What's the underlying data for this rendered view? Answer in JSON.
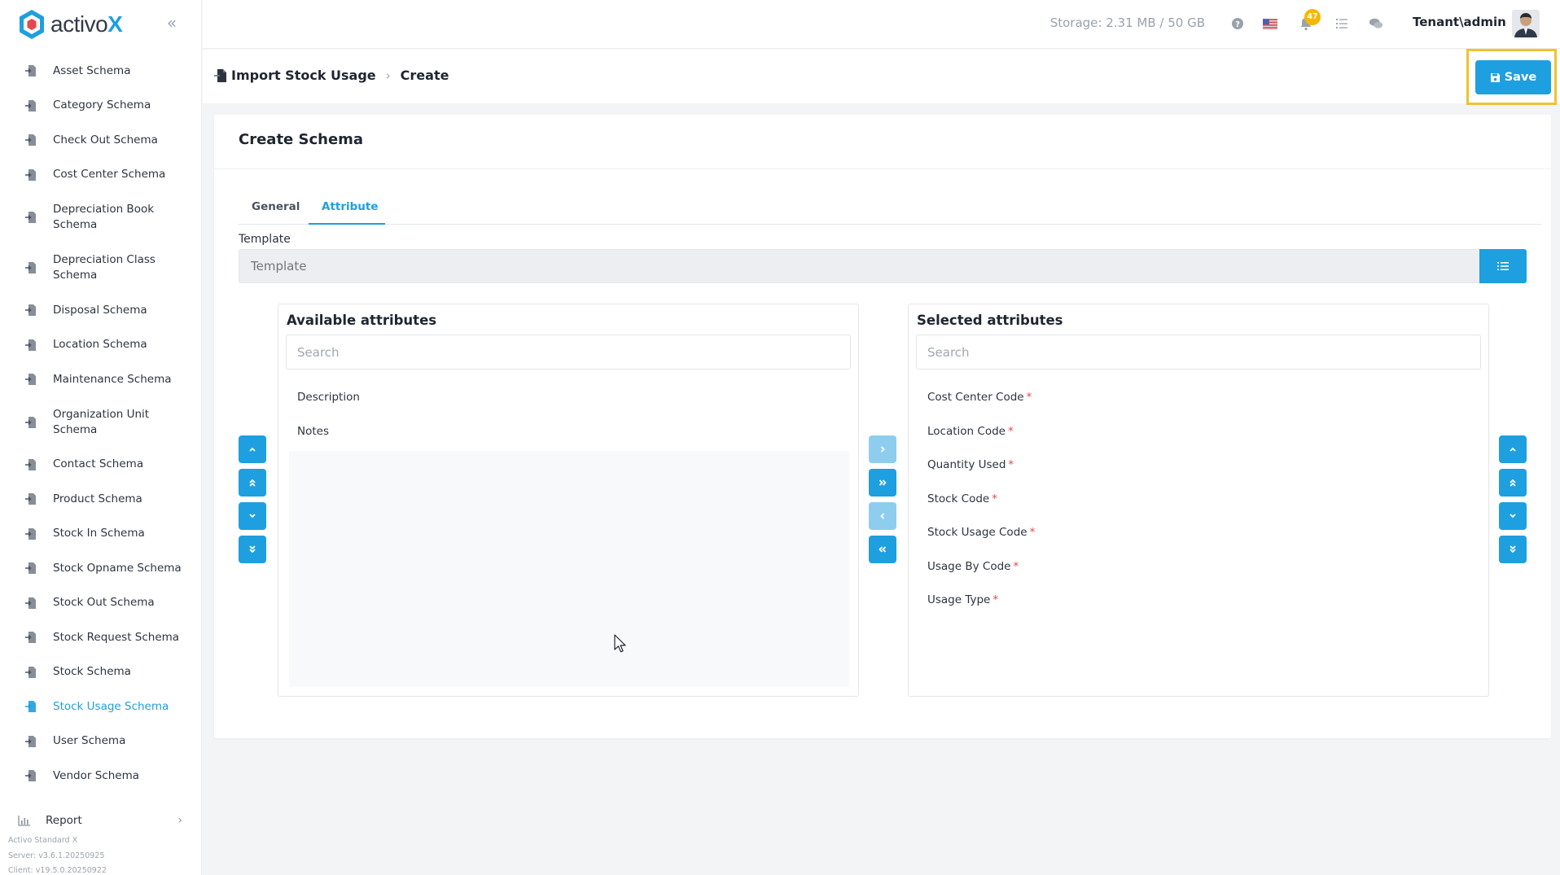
{
  "app": {
    "logo_text": "activo",
    "logo_accent": "X",
    "brand_color": "#1e9fdf"
  },
  "sidebar": {
    "items": [
      {
        "label": "Asset Schema",
        "icon": "import-doc-icon",
        "two_line": false,
        "active": false
      },
      {
        "label": "Category Schema",
        "icon": "import-doc-icon",
        "two_line": false,
        "active": false
      },
      {
        "label": "Check Out Schema",
        "icon": "import-doc-icon",
        "two_line": false,
        "active": false
      },
      {
        "label": "Cost Center Schema",
        "icon": "import-doc-icon",
        "two_line": false,
        "active": false
      },
      {
        "label": "Depreciation Book Schema",
        "icon": "import-doc-icon",
        "two_line": true,
        "active": false
      },
      {
        "label": "Depreciation Class Schema",
        "icon": "import-doc-icon",
        "two_line": true,
        "active": false
      },
      {
        "label": "Disposal Schema",
        "icon": "import-doc-icon",
        "two_line": false,
        "active": false
      },
      {
        "label": "Location Schema",
        "icon": "import-doc-icon",
        "two_line": false,
        "active": false
      },
      {
        "label": "Maintenance Schema",
        "icon": "import-doc-icon",
        "two_line": false,
        "active": false
      },
      {
        "label": "Organization Unit Schema",
        "icon": "import-doc-icon",
        "two_line": true,
        "active": false
      },
      {
        "label": "Contact Schema",
        "icon": "import-doc-icon",
        "two_line": false,
        "active": false
      },
      {
        "label": "Product Schema",
        "icon": "import-doc-icon",
        "two_line": false,
        "active": false
      },
      {
        "label": "Stock In Schema",
        "icon": "import-doc-icon",
        "two_line": false,
        "active": false
      },
      {
        "label": "Stock Opname Schema",
        "icon": "import-doc-icon",
        "two_line": false,
        "active": false
      },
      {
        "label": "Stock Out Schema",
        "icon": "import-doc-icon",
        "two_line": false,
        "active": false
      },
      {
        "label": "Stock Request Schema",
        "icon": "import-doc-icon",
        "two_line": false,
        "active": false
      },
      {
        "label": "Stock Schema",
        "icon": "import-doc-icon",
        "two_line": false,
        "active": false
      },
      {
        "label": "Stock Usage Schema",
        "icon": "import-doc-icon",
        "two_line": false,
        "active": true
      },
      {
        "label": "User Schema",
        "icon": "import-doc-icon",
        "two_line": false,
        "active": false
      },
      {
        "label": "Vendor Schema",
        "icon": "import-doc-icon",
        "two_line": false,
        "active": false
      }
    ],
    "report_label": "Report",
    "footer": {
      "product": "Activo Standard X",
      "server": "Server: v3.6.1.20250925",
      "client": "Client: v19.5.0.20250922"
    }
  },
  "topbar": {
    "storage": "Storage: 2.31 MB / 50 GB",
    "notification_count": "47",
    "user": "Tenant\\admin"
  },
  "header": {
    "breadcrumb_root": "Import Stock Usage",
    "breadcrumb_current": "Create",
    "save_label": "Save"
  },
  "card": {
    "title": "Create Schema",
    "tabs": [
      {
        "label": "General",
        "active": false
      },
      {
        "label": "Attribute",
        "active": true
      }
    ],
    "template_label": "Template",
    "template_placeholder": "Template",
    "available": {
      "title": "Available attributes",
      "search_placeholder": "Search",
      "items": [
        "Description",
        "Notes"
      ]
    },
    "selected": {
      "title": "Selected attributes",
      "search_placeholder": "Search",
      "items": [
        "Cost Center Code",
        "Location Code",
        "Quantity Used",
        "Stock Code",
        "Stock Usage Code",
        "Usage By Code",
        "Usage Type"
      ],
      "required_marker": "*"
    }
  }
}
